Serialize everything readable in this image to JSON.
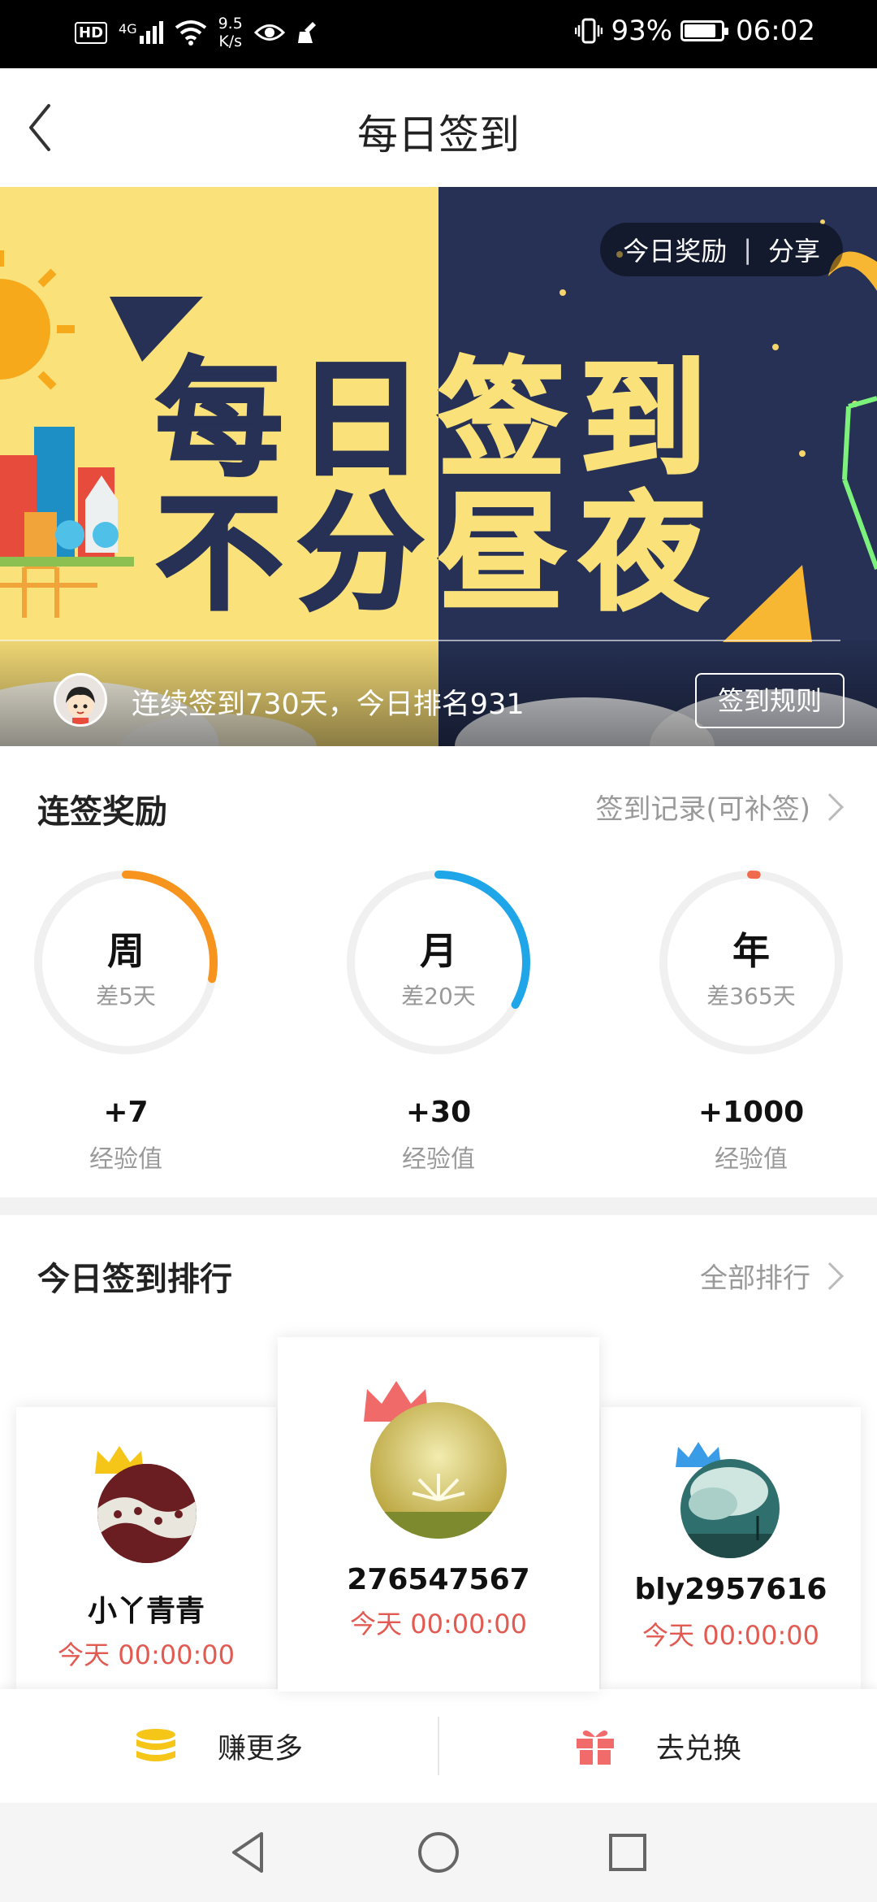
{
  "status_bar": {
    "hd": "HD",
    "network": "4G",
    "speed_value": "9.5",
    "speed_unit": "K/s",
    "battery": "93%",
    "battery_level": 0.93,
    "time": "06:02"
  },
  "header": {
    "title": "每日签到"
  },
  "banner": {
    "line1": "每日签到",
    "line2": "不分昼夜",
    "reward_label": "今日奖励",
    "share_label": "分享",
    "streak_text": "连续签到730天，今日排名931",
    "rules_label": "签到规则"
  },
  "rewards": {
    "title": "连签奖励",
    "record_link": "签到记录(可补签)",
    "items": [
      {
        "label": "周",
        "remaining": "差5天",
        "points": "+7",
        "unit": "经验值",
        "color": "#f7941d",
        "progress": 0.28
      },
      {
        "label": "月",
        "remaining": "差20天",
        "points": "+30",
        "unit": "经验值",
        "color": "#1fa6e8",
        "progress": 0.33
      },
      {
        "label": "年",
        "remaining": "差365天",
        "points": "+1000",
        "unit": "经验值",
        "color": "#f06a4e",
        "progress": 0.01
      }
    ]
  },
  "ranking": {
    "title": "今日签到排行",
    "all_link": "全部排行",
    "entries": [
      {
        "rank": 2,
        "name": "小丫青青",
        "time": "今天 00:00:00",
        "crown_color": "#f5c518"
      },
      {
        "rank": 1,
        "name": "276547567",
        "time": "今天 00:00:00",
        "crown_color": "#f06a6a"
      },
      {
        "rank": 3,
        "name": "bly2957616",
        "time": "今天 00:00:00",
        "crown_color": "#3a9be6"
      }
    ]
  },
  "bottom_bar": {
    "earn_label": "赚更多",
    "redeem_label": "去兑换"
  }
}
